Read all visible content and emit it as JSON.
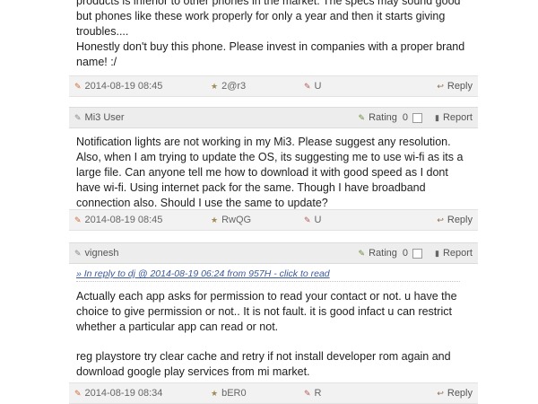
{
  "comments": [
    {
      "body": [
        "products is inferior to other phones in the market. The specs may sound good but phones like these work properly for only a year and then it starts giving troubles....",
        "Honestly don't buy this phone. Please invest in companies with a proper brand name! :/"
      ],
      "footer": {
        "date": "2014-08-19 08:45",
        "uid": "2@r3",
        "ip": "U",
        "reply": "Reply"
      }
    },
    {
      "author": "Mi3 User",
      "rating_label": "Rating",
      "rating_value": "0",
      "report": "Report",
      "body": [
        "Notification lights are not working in my Mi3. Please suggest any resolution. Also, when I am trying to update the OS, its suggesting me to use wi-fi as its a large file. Can anyone tell me how to download it with good speed as I dont have wi-fi. Using internet pack for the same. Though I have broadband connection also. Should I use the same to update?"
      ],
      "footer": {
        "date": "2014-08-19 08:45",
        "uid": "RwQG",
        "ip": "U",
        "reply": "Reply"
      }
    },
    {
      "author": "vignesh",
      "rating_label": "Rating",
      "rating_value": "0",
      "report": "Report",
      "in_reply": "» In reply to dj @ 2014-08-19 06:24 from 957H - click to read",
      "body": [
        "Actually each app asks for permission to read your contact or not. u have the choice to give permission or not.. It is not fault. it is good infact u can restrict whether a particular app can read or not.",
        "reg playstore try clear cache and retry if not install developer rom again and download google play services from mi market."
      ],
      "footer": {
        "date": "2014-08-19 08:34",
        "uid": "bER0",
        "ip": "R",
        "reply": "Reply"
      }
    }
  ],
  "icons": {
    "date": "calendar-icon",
    "uid": "user-id-icon",
    "ip": "location-icon",
    "reply": "reply-icon",
    "author": "person-icon",
    "rating": "rating-icon",
    "report": "report-icon"
  }
}
